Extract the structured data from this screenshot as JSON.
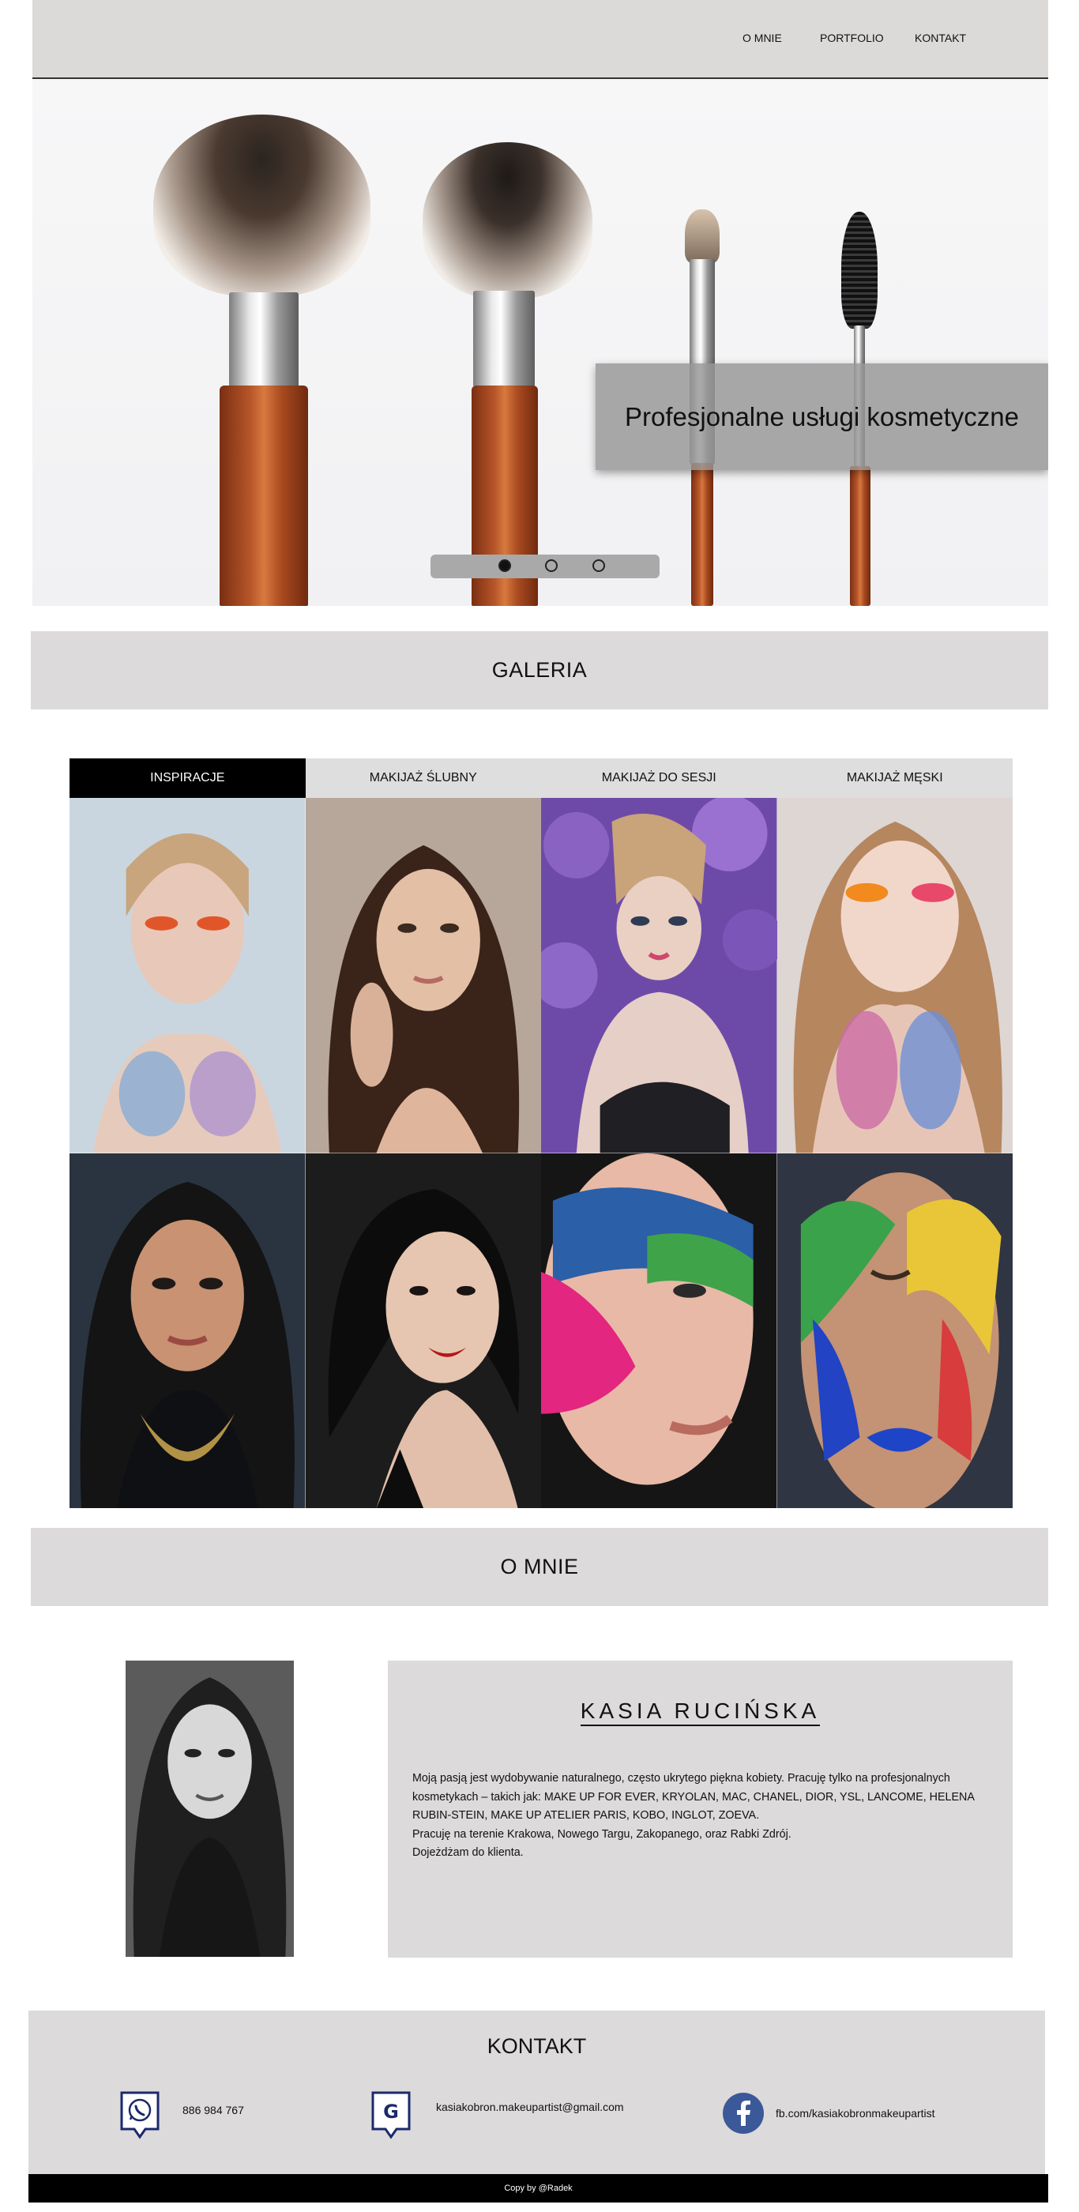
{
  "nav": {
    "items": [
      {
        "label": "O MNIE"
      },
      {
        "label": "PORTFOLIO"
      },
      {
        "label": "KONTAKT"
      }
    ]
  },
  "hero": {
    "caption": "Profesjonalne usługi kosmetyczne",
    "slides_count": 3,
    "active_slide": 1
  },
  "gallery": {
    "heading": "GALERIA",
    "tabs": [
      {
        "label": "INSPIRACJE",
        "active": true
      },
      {
        "label": "MAKIJAŻ ŚLUBNY",
        "active": false
      },
      {
        "label": "MAKIJAŻ DO SESJI",
        "active": false
      },
      {
        "label": "MAKIJAŻ MĘSKI",
        "active": false
      }
    ]
  },
  "about": {
    "heading": "O MNIE",
    "name": "KASIA RUCIŃSKA",
    "paragraphs": [
      "Moją pasją jest wydobywanie naturalnego, często ukrytego piękna kobiety. Pracuję tylko na profesjonalnych kosmetykach – takich jak: MAKE UP FOR EVER, KRYOLAN, MAC, CHANEL, DIOR, YSL, LANCOME, HELENA RUBIN-STEIN, MAKE UP ATELIER PARIS, KOBO, INGLOT, ZOEVA.",
      "Pracuję na terenie Krakowa, Nowego Targu, Zakopanego, oraz Rabki Zdrój.",
      "Dojeżdżam do klienta."
    ]
  },
  "contact": {
    "heading": "KONTAKT",
    "phone": "886 984 767",
    "email": "kasiakobron.makeupartist@gmail.com",
    "facebook": "fb.com/kasiakobronmakeupartist"
  },
  "footer": {
    "text": "Copy by @Radek"
  },
  "colors": {
    "band_gray": "#dcdada",
    "nav_gray": "#dcd9d9",
    "tab_active_bg": "#000000",
    "icon_blue": "#1b2a6b",
    "facebook_blue": "#3b5998"
  }
}
